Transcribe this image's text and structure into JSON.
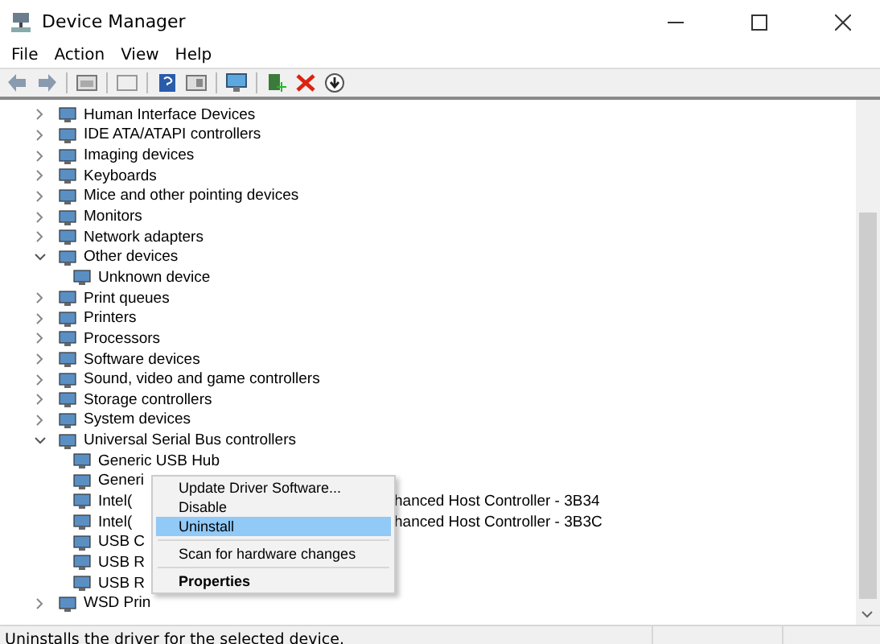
{
  "window": {
    "title": "Device Manager"
  },
  "menu": [
    "File",
    "Action",
    "View",
    "Help"
  ],
  "tree": [
    {
      "label": "Human Interface Devices",
      "expanded": false
    },
    {
      "label": "IDE ATA/ATAPI controllers",
      "expanded": false
    },
    {
      "label": "Imaging devices",
      "expanded": false
    },
    {
      "label": "Keyboards",
      "expanded": false
    },
    {
      "label": "Mice and other pointing devices",
      "expanded": false
    },
    {
      "label": "Monitors",
      "expanded": false
    },
    {
      "label": "Network adapters",
      "expanded": false
    },
    {
      "label": "Other devices",
      "expanded": true,
      "children": [
        {
          "label": "Unknown device"
        }
      ]
    },
    {
      "label": "Print queues",
      "expanded": false
    },
    {
      "label": "Printers",
      "expanded": false
    },
    {
      "label": "Processors",
      "expanded": false
    },
    {
      "label": "Software devices",
      "expanded": false
    },
    {
      "label": "Sound, video and game controllers",
      "expanded": false
    },
    {
      "label": "Storage controllers",
      "expanded": false
    },
    {
      "label": "System devices",
      "expanded": false
    },
    {
      "label": "Universal Serial Bus controllers",
      "expanded": true,
      "children": [
        {
          "label": "Generic USB Hub"
        },
        {
          "label": "Generi"
        },
        {
          "label": "Intel(",
          "tail": "hanced Host Controller - 3B34"
        },
        {
          "label": "Intel(",
          "tail": "hanced Host Controller - 3B3C"
        },
        {
          "label": "USB C"
        },
        {
          "label": "USB R"
        },
        {
          "label": "USB R"
        }
      ]
    },
    {
      "label": "WSD Prin",
      "expanded": false
    }
  ],
  "context_menu": [
    {
      "label": "Update Driver Software...",
      "kind": "item",
      "selected": false
    },
    {
      "label": "Disable",
      "kind": "item",
      "selected": false
    },
    {
      "label": "Uninstall",
      "kind": "item",
      "selected": true
    },
    {
      "kind": "separator"
    },
    {
      "label": "Scan for hardware changes",
      "kind": "item",
      "selected": false
    },
    {
      "kind": "separator"
    },
    {
      "label": "Properties",
      "kind": "default",
      "selected": false
    }
  ],
  "status_bar": "Uninstalls the driver for the selected device."
}
